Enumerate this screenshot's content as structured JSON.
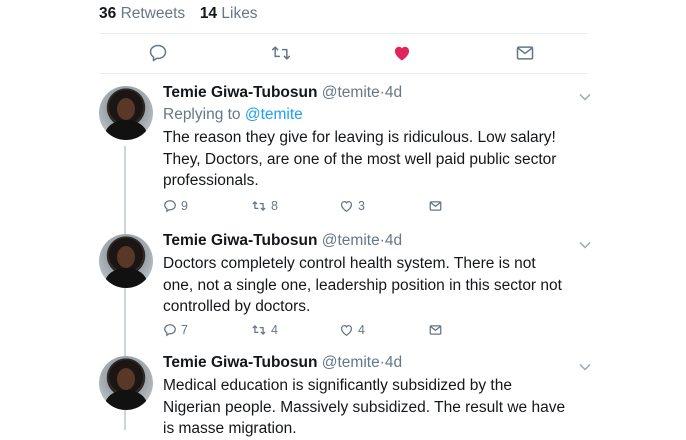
{
  "stats": {
    "retweets_count": "36",
    "retweets_label": "Retweets",
    "likes_count": "14",
    "likes_label": "Likes"
  },
  "action_bar": {
    "icons": [
      "reply-icon",
      "retweet-icon",
      "heart-filled-icon",
      "message-icon"
    ],
    "liked_color": "#e0245e"
  },
  "replies": [
    {
      "name": "Temie Giwa-Tubosun",
      "handle": "@temite",
      "dot": "·",
      "time": "4d",
      "replying_prefix": "Replying to",
      "replying_mention": "@temite",
      "lines": [
        "The reason they give for leaving is ridiculous. Low salary!",
        "They, Doctors, are one of the most well paid public sector",
        "professionals."
      ],
      "reply_count": "9",
      "retweet_count": "8",
      "like_count": "3"
    },
    {
      "name": "Temie Giwa-Tubosun",
      "handle": "@temite",
      "dot": "·",
      "time": "4d",
      "lines": [
        "Doctors completely control health system. There is not",
        "one, not a single one, leadership position in this sector not",
        "controlled by doctors."
      ],
      "reply_count": "7",
      "retweet_count": "4",
      "like_count": "4"
    },
    {
      "name": "Temie Giwa-Tubosun",
      "handle": "@temite",
      "dot": "·",
      "time": "4d",
      "lines": [
        "Medical education is significantly subsidized by the",
        "Nigerian people. Massively subsidized. The result we have",
        "is masse migration."
      ]
    }
  ],
  "colors": {
    "text": "#14171a",
    "secondary": "#657786",
    "link": "#1da1f2",
    "divider": "#e6ecf0",
    "thread_line": "#ccd6dd"
  }
}
